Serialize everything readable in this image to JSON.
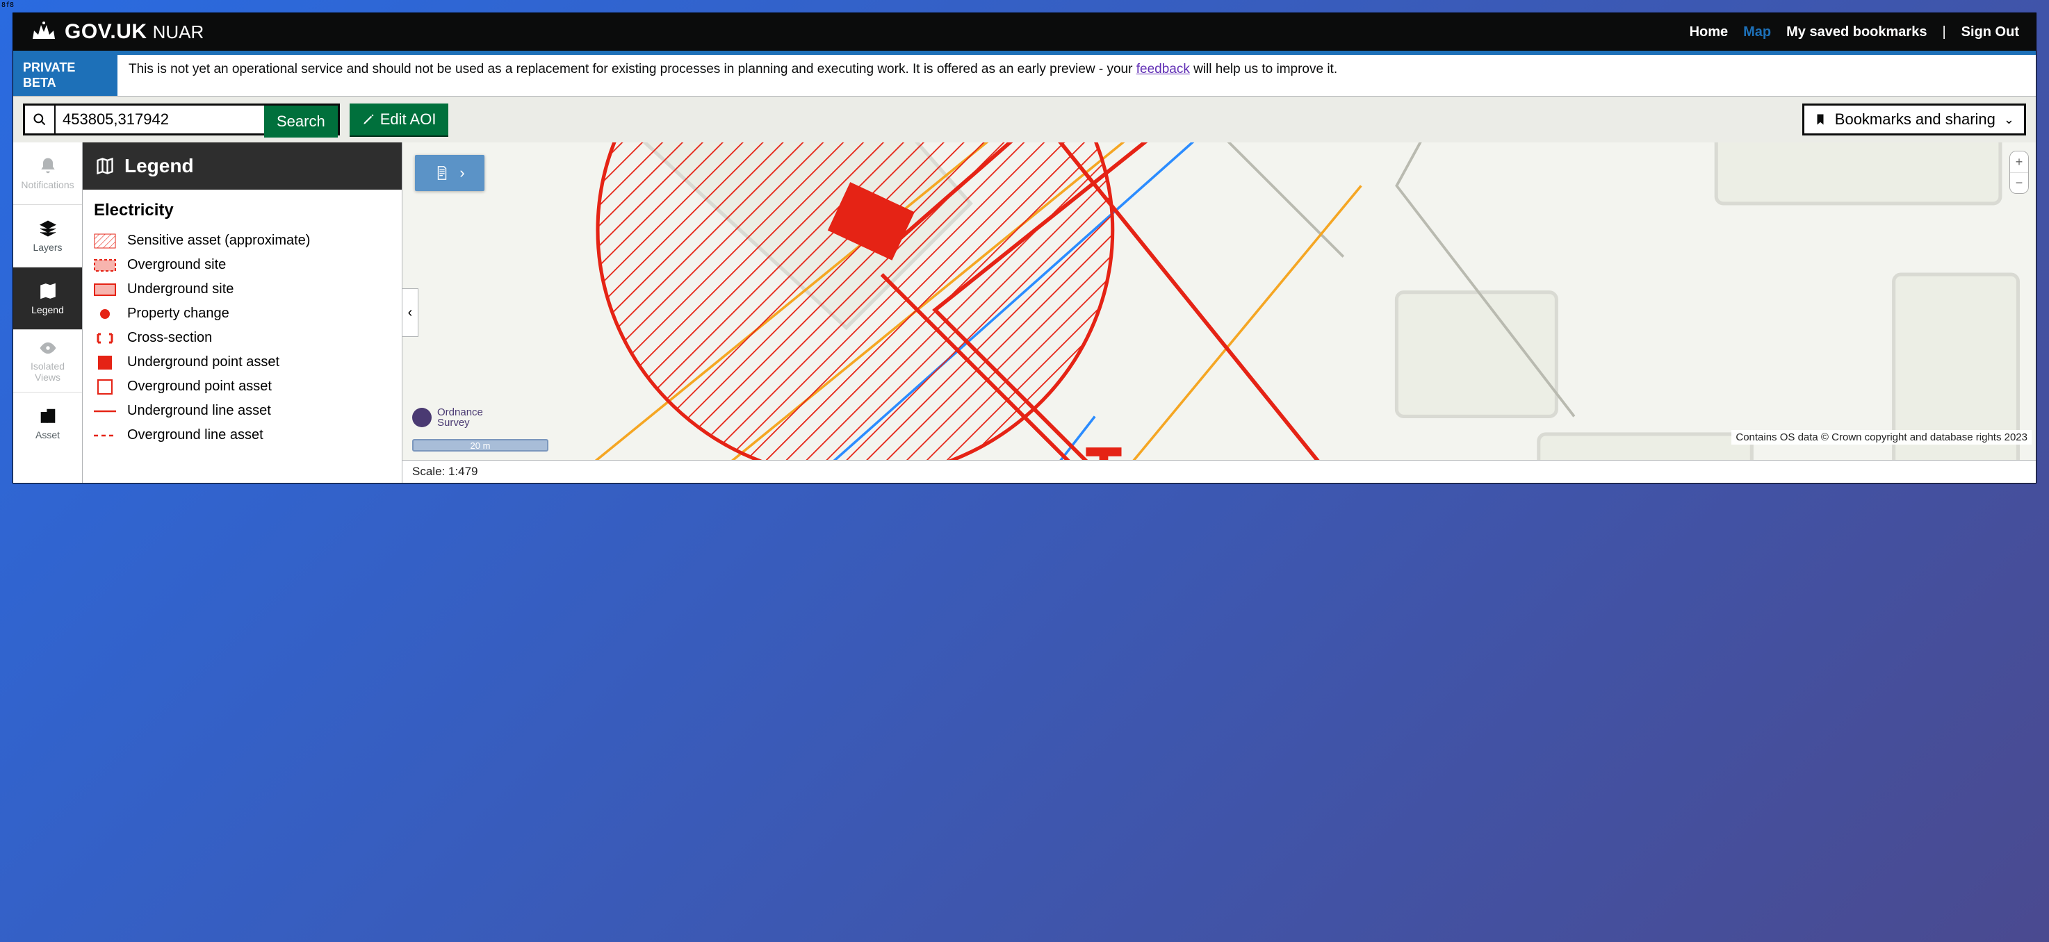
{
  "header": {
    "brand": "GOV.UK",
    "product": "NUAR",
    "nav": {
      "home": "Home",
      "map": "Map",
      "bookmarks": "My saved bookmarks",
      "sep": "|",
      "signout": "Sign Out"
    }
  },
  "beta": {
    "tag_line1": "PRIVATE",
    "tag_line2": "BETA",
    "msg_pre": "This is not yet an operational service and should not be used as a replacement for existing processes in planning and executing work. It is offered as an early preview - your ",
    "link": "feedback",
    "msg_post": " will help us to improve it."
  },
  "toolbar": {
    "search_value": "453805,317942",
    "search_btn": "Search",
    "edit_aoi": "Edit AOI",
    "bookmarks": "Bookmarks and sharing"
  },
  "rail": {
    "notifications": "Notifications",
    "layers": "Layers",
    "legend": "Legend",
    "isolated": "Isolated\nViews",
    "isolated_l1": "Isolated",
    "isolated_l2": "Views",
    "asset": "Asset"
  },
  "legend": {
    "title": "Legend",
    "category": "Electricity",
    "items": [
      {
        "label": "Sensitive asset (approximate)",
        "kind": "hatch"
      },
      {
        "label": "Overground site",
        "kind": "dashed-box"
      },
      {
        "label": "Underground site",
        "kind": "solid-box-light"
      },
      {
        "label": "Property change",
        "kind": "dot"
      },
      {
        "label": "Cross-section",
        "kind": "bracket"
      },
      {
        "label": "Underground point asset",
        "kind": "solid-box"
      },
      {
        "label": "Overground point asset",
        "kind": "hollow-box"
      },
      {
        "label": "Underground line asset",
        "kind": "solid-line"
      },
      {
        "label": "Overground line asset",
        "kind": "dashed-line"
      }
    ]
  },
  "map": {
    "scale_bar": "20 m",
    "scale_text": "Scale: 1:479",
    "attribution": "Contains OS data © Crown copyright and database rights 2023",
    "os_l1": "Ordnance",
    "os_l2": "Survey"
  },
  "colors": {
    "electricity": "#e52315",
    "accent_blue": "#1d70b8",
    "green": "#00703c"
  }
}
